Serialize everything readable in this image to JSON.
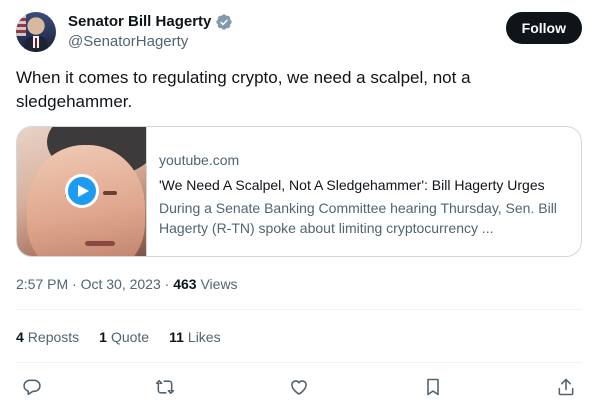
{
  "author": {
    "display_name": "Senator Bill Hagerty",
    "handle": "@SenatorHagerty",
    "verified_icon": "verified-badge-icon",
    "avatar_icon": "avatar"
  },
  "follow_label": "Follow",
  "tweet": {
    "text": "When it comes to regulating crypto, we need a scalpel, not a sledgehammer."
  },
  "card": {
    "domain": "youtube.com",
    "title": "'We Need A Scalpel, Not A Sledgehammer': Bill Hagerty Urges",
    "description": "During a Senate Banking Committee hearing Thursday, Sen. Bill Hagerty (R-TN) spoke about limiting cryptocurrency ...",
    "play_icon": "play-icon"
  },
  "meta": {
    "time": "2:57 PM",
    "sep1": "·",
    "date": "Oct 30, 2023",
    "sep2": "·",
    "views_count": "463",
    "views_label": "Views"
  },
  "stats": {
    "reposts_count": "4",
    "reposts_label": "Reposts",
    "quotes_count": "1",
    "quotes_label": "Quote",
    "likes_count": "11",
    "likes_label": "Likes"
  },
  "actions": [
    "reply-icon",
    "repost-icon",
    "like-icon",
    "bookmark-icon",
    "share-icon"
  ],
  "colors": {
    "accent": "#1d9bf0",
    "text": "#0f1419",
    "muted": "#536471",
    "border": "#cfd9de"
  }
}
